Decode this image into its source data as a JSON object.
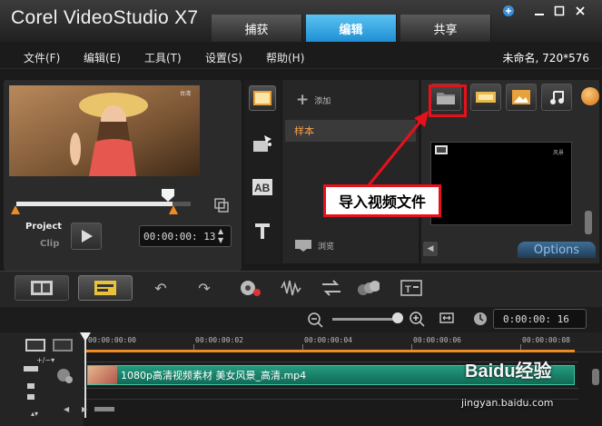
{
  "app": {
    "title": "Corel  VideoStudio X7",
    "tabs": [
      {
        "label": "捕获",
        "active": false
      },
      {
        "label": "编辑",
        "active": true
      },
      {
        "label": "共享",
        "active": false
      }
    ],
    "project_info": "未命名, 720*576"
  },
  "menu": {
    "items": [
      "文件(F)",
      "编辑(E)",
      "工具(T)",
      "设置(S)",
      "帮助(H)"
    ]
  },
  "player": {
    "project_label": "Project",
    "clip_label": "Clip",
    "timecode": "00:00:00: 13",
    "preview_watermark": "台湾"
  },
  "library": {
    "add_label": "添加",
    "sample_item": "样本",
    "browse_label": "浏览",
    "options_label": "Options",
    "thumb_text": "风景"
  },
  "annotation": {
    "callout_text": "导入视频文件",
    "color": "#e8101a"
  },
  "timeline": {
    "duration": "0:00:00: 16",
    "ruler_labels": [
      "00:00:00:00",
      "00:00:00:02",
      "00:00:00:04",
      "00:00:00:06",
      "00:00:00:08"
    ],
    "clip_name": "1080p高清视频素材 美女风景_高清.mp4"
  },
  "watermark": {
    "logo": "Baidu经验",
    "url": "jingyan.baidu.com"
  },
  "colors": {
    "accent_tab": "#2a9de0",
    "accent_orange": "#f18a21",
    "clip_green": "#1a8468"
  }
}
